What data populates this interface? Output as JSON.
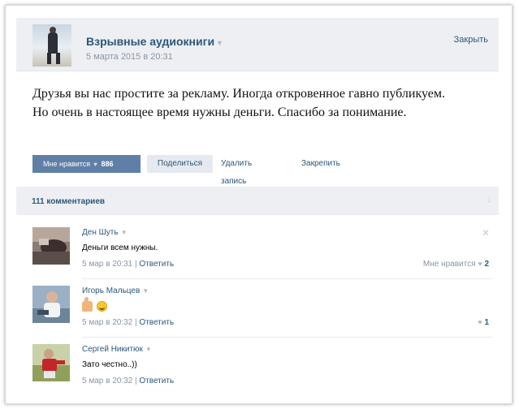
{
  "post": {
    "group_name": "Взрывные аудиокниги",
    "date": "5 марта 2015 в 20:31",
    "pin_label": "Закрыть",
    "text": "Друзья вы нас простите за рекламу. Иногда откровенное гавно публикуем. Но очень в настоящее время нужны деньги. Спасибо за понимание.",
    "like_label": "Мне нравится",
    "like_count": "886",
    "share_label": "Поделиться",
    "delete_label": "Удалить запись",
    "pin_post_label": "Закрепить"
  },
  "comments_header": {
    "count_label": "111 комментариев"
  },
  "comments": [
    {
      "author": "Ден Шуть",
      "text": "Деньги всем нужны.",
      "date": "5 мар в 20:31",
      "reply": "Ответить",
      "like_label": "Мне нравится",
      "likes": "2"
    },
    {
      "author": "Игорь Мальцев",
      "text": "",
      "date": "5 мар в 20:32",
      "reply": "Ответить",
      "likes": "1"
    },
    {
      "author": "Сергей Никитюк",
      "text": "Зато честно..))",
      "date": "5 мар в 20:32",
      "reply": "Ответить"
    }
  ],
  "icons": {
    "like": "heart-icon",
    "close": "close-icon",
    "sort": "sort-arrow-icon",
    "dropdown": "chevron-down-icon",
    "thumbs_up_emoji": "thumbs-up-icon",
    "smile_emoji": "smile-icon"
  },
  "colors": {
    "link": "#2b587a",
    "header_bg": "#edeff3",
    "like_button_bg": "#5f7fa6",
    "muted": "#8a95a4"
  }
}
